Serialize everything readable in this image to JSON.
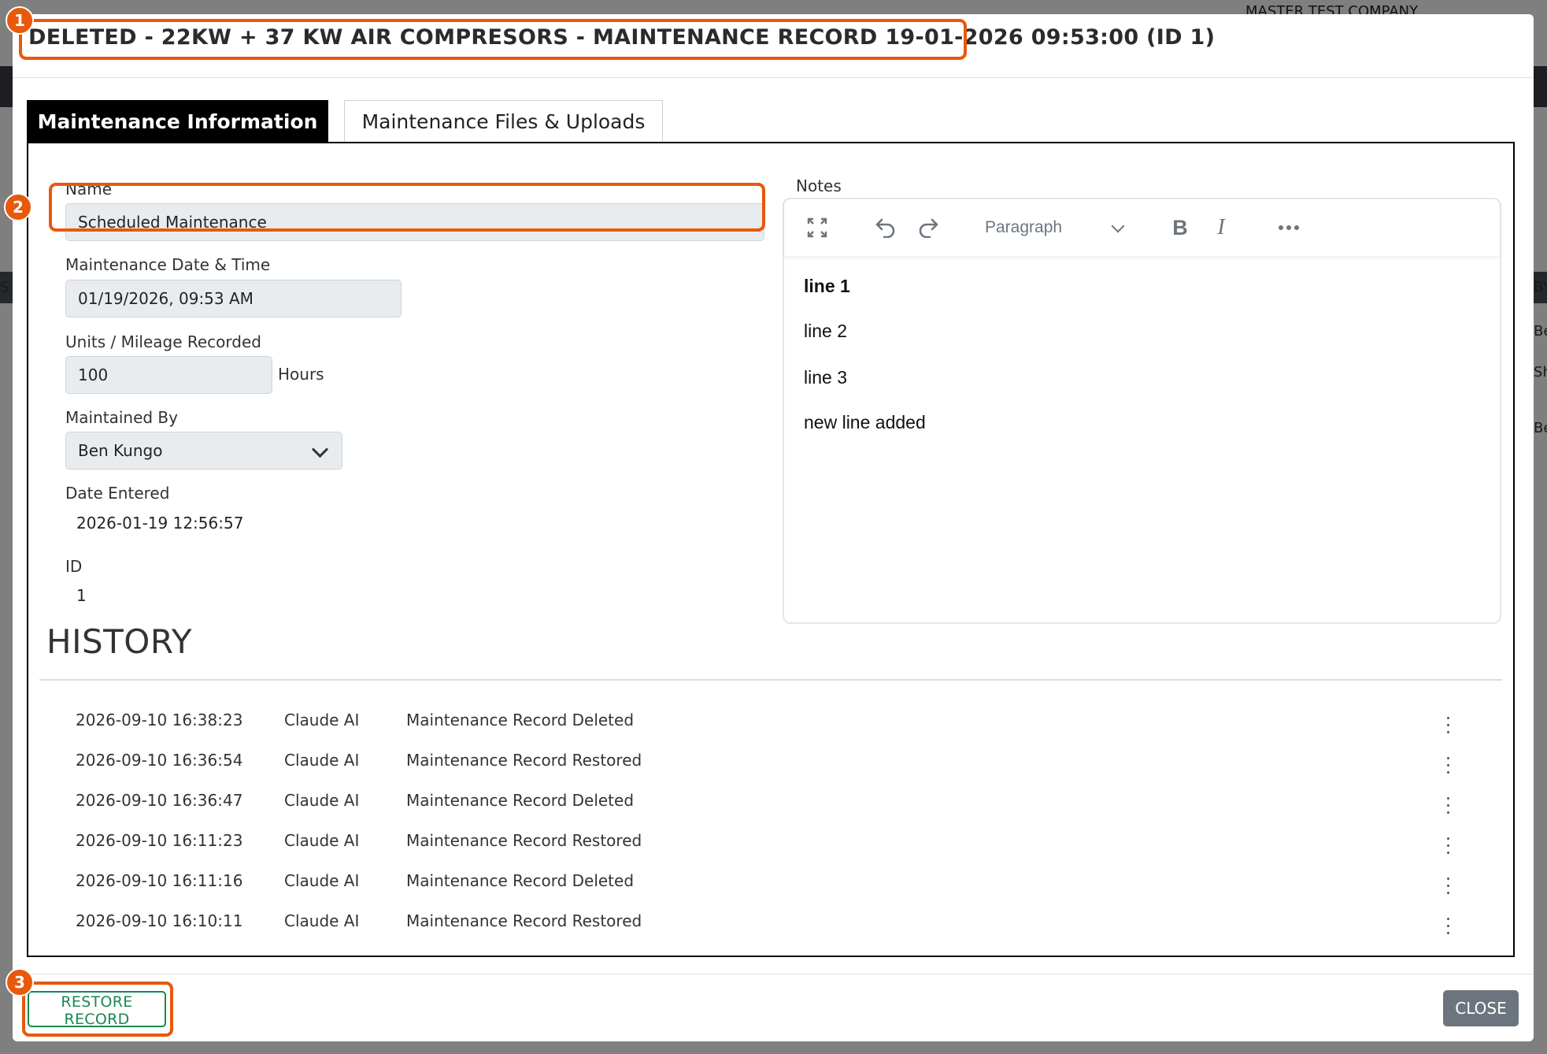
{
  "background": {
    "company_name": "MASTER TEST COMPANY",
    "side_texts": [
      "S",
      "BY",
      "Be",
      "Sh",
      "Be"
    ]
  },
  "modal": {
    "title": "DELETED - 22KW + 37 KW AIR COMPRESORS - MAINTENANCE RECORD 19-01-2026 09:53:00 (ID 1)",
    "tabs": [
      {
        "label": "Maintenance Information",
        "active": true
      },
      {
        "label": "Maintenance Files & Uploads",
        "active": false
      }
    ],
    "form": {
      "name_label": "Name",
      "name_value": "Scheduled Maintenance",
      "date_label": "Maintenance Date & Time",
      "date_value": "01/19/2026, 09:53 AM",
      "units_label": "Units / Mileage Recorded",
      "units_value": "100",
      "units_suffix": "Hours",
      "maintained_by_label": "Maintained By",
      "maintained_by_value": "Ben Kungo",
      "date_entered_label": "Date Entered",
      "date_entered_value": "2026-01-19 12:56:57",
      "id_label": "ID",
      "id_value": "1"
    },
    "notes": {
      "label": "Notes",
      "toolbar": {
        "icons": [
          "fullscreen-icon",
          "undo-icon",
          "redo-icon",
          "bold-icon",
          "italic-icon",
          "more-icon"
        ],
        "paragraph_select": "Paragraph",
        "bold_glyph": "B",
        "italic_glyph": "I"
      },
      "lines": [
        "line 1",
        "line 2",
        "line 3",
        "new line added"
      ]
    },
    "history": {
      "title": "HISTORY",
      "rows": [
        {
          "timestamp": "2026-09-10 16:38:23",
          "user": "Claude AI",
          "action": "Maintenance Record Deleted"
        },
        {
          "timestamp": "2026-09-10 16:36:54",
          "user": "Claude AI",
          "action": "Maintenance Record Restored"
        },
        {
          "timestamp": "2026-09-10 16:36:47",
          "user": "Claude AI",
          "action": "Maintenance Record Deleted"
        },
        {
          "timestamp": "2026-09-10 16:11:23",
          "user": "Claude AI",
          "action": "Maintenance Record Restored"
        },
        {
          "timestamp": "2026-09-10 16:11:16",
          "user": "Claude AI",
          "action": "Maintenance Record Deleted"
        },
        {
          "timestamp": "2026-09-10 16:10:11",
          "user": "Claude AI",
          "action": "Maintenance Record Restored"
        }
      ]
    },
    "footer": {
      "restore_label": "RESTORE RECORD",
      "close_label": "CLOSE"
    }
  },
  "markers": [
    "1",
    "2",
    "3"
  ],
  "colors": {
    "highlight": "#e8590c",
    "restore_green": "#198754",
    "close_gray": "#6c757d",
    "tab_active_bg": "#000000"
  }
}
